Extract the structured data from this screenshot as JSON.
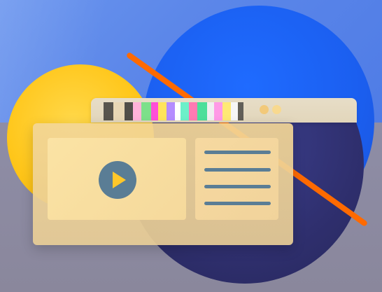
{
  "window": {
    "title_text": "",
    "controls": [
      {
        "name": "minimize",
        "color": "#f2c97a"
      },
      {
        "name": "maximize",
        "color": "#f8d98f"
      }
    ]
  },
  "media": {
    "icon": "play-icon",
    "list_icon": "list-icon",
    "list_item_count_shown": 4
  },
  "colors": {
    "accent_play": "#5a7d95",
    "play_glyph": "#ffc72a",
    "orange_line": "#ff6a00",
    "blue_circle": "#1f6bff",
    "yellow_circle": "#ffc71c",
    "navy_circle": "#2f2f6e"
  }
}
